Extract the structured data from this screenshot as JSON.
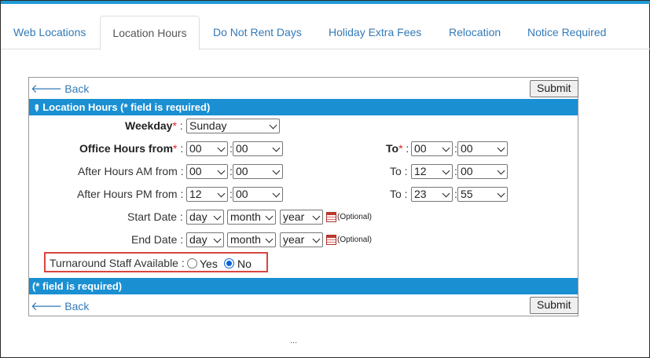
{
  "tabs": [
    {
      "label": "Web Locations",
      "active": false
    },
    {
      "label": "Location Hours",
      "active": true
    },
    {
      "label": "Do Not Rent Days",
      "active": false
    },
    {
      "label": "Holiday Extra Fees",
      "active": false
    },
    {
      "label": "Relocation",
      "active": false
    },
    {
      "label": "Notice Required",
      "active": false
    }
  ],
  "nav": {
    "back_label": "Back",
    "submit_label": "Submit"
  },
  "form": {
    "header": "Location Hours (* field is required)",
    "footer": "(* field is required)",
    "weekday": {
      "label": "Weekday",
      "value": "Sunday"
    },
    "office_hours": {
      "from_label": "Office Hours from",
      "to_label": "To",
      "from_hour": "00",
      "from_min": "00",
      "to_hour": "00",
      "to_min": "00"
    },
    "after_am": {
      "from_label": "After Hours AM from :",
      "to_label": "To :",
      "from_hour": "00",
      "from_min": "00",
      "to_hour": "12",
      "to_min": "00"
    },
    "after_pm": {
      "from_label": "After Hours PM from :",
      "to_label": "To :",
      "from_hour": "12",
      "from_min": "00",
      "to_hour": "23",
      "to_min": "55"
    },
    "start_date": {
      "label": "Start Date :",
      "day": "day",
      "month": "month",
      "year": "year",
      "optional": "(Optional)"
    },
    "end_date": {
      "label": "End Date :",
      "day": "day",
      "month": "month",
      "year": "year",
      "optional": "(Optional)"
    },
    "turnaround": {
      "label": "Turnaround Staff Available :",
      "yes": "Yes",
      "no": "No",
      "selected": "No"
    }
  },
  "footer_ellipsis": "...",
  "colors": {
    "accent": "#1a8fd2",
    "link": "#337ab7",
    "highlight": "#d9453d",
    "required": "#e02020"
  },
  "icons": [
    "back-arrow-icon",
    "pencil-icon",
    "calendar-icon",
    "chevron-down-icon"
  ]
}
